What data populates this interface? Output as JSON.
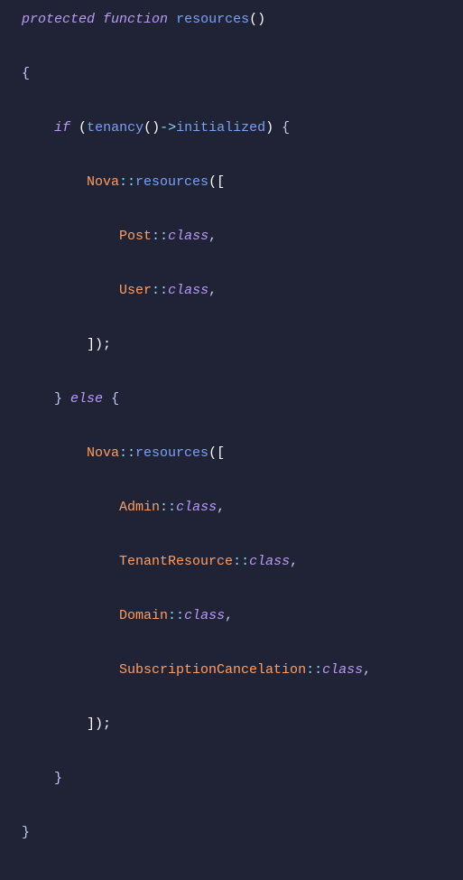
{
  "code": {
    "l1": {
      "protected": "protected",
      "function": "function",
      "name": "resources",
      "parens": "()"
    },
    "l2": {
      "brace": "{"
    },
    "l3": {
      "if": "if",
      "open": "(",
      "tenancy": "tenancy",
      "parens": "()",
      "arrow": "->",
      "initialized": "initialized",
      "close": ")",
      "brace": "{"
    },
    "l4": {
      "nova": "Nova",
      "dd": "::",
      "method": "resources",
      "open": "(["
    },
    "l5": {
      "cls": "Post",
      "dd": "::",
      "class": "class",
      "comma": ","
    },
    "l6": {
      "cls": "User",
      "dd": "::",
      "class": "class",
      "comma": ","
    },
    "l7": {
      "close": "]);"
    },
    "l8": {
      "cbrace": "}",
      "else": "else",
      "obrace": "{"
    },
    "l9": {
      "nova": "Nova",
      "dd": "::",
      "method": "resources",
      "open": "(["
    },
    "l10": {
      "cls": "Admin",
      "dd": "::",
      "class": "class",
      "comma": ","
    },
    "l11": {
      "cls": "TenantResource",
      "dd": "::",
      "class": "class",
      "comma": ","
    },
    "l12": {
      "cls": "Domain",
      "dd": "::",
      "class": "class",
      "comma": ","
    },
    "l13": {
      "cls": "SubscriptionCancelation",
      "dd": "::",
      "class": "class",
      "comma": ","
    },
    "l14": {
      "close": "]);"
    },
    "l15": {
      "brace": "}"
    },
    "l16": {
      "brace": "}"
    }
  }
}
